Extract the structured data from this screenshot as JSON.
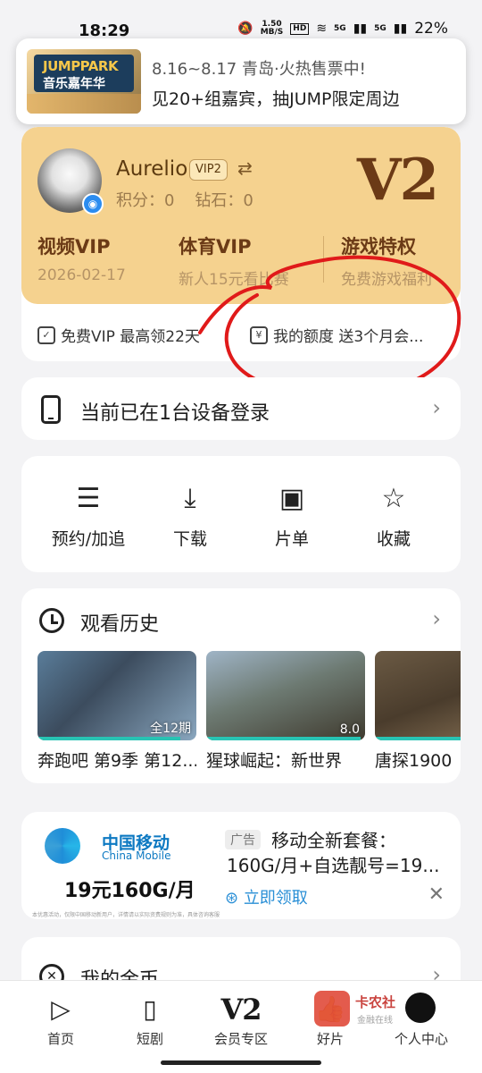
{
  "status_bar": {
    "time": "18:29",
    "speed": "1.50",
    "speed_unit": "MB/S",
    "hd": "HD",
    "net1": "5G",
    "net2": "5G",
    "battery": "22%"
  },
  "notification": {
    "thumb_brand": "JUMPPARK",
    "thumb_sub": "音乐嘉年华",
    "title": "8.16~8.17 青岛·火热售票中!",
    "body": "见20+组嘉宾，抽JUMP限定周边"
  },
  "profile": {
    "name": "Aurelio",
    "vip_badge": "VIP2",
    "points_label": "积分：",
    "points": "0",
    "diamonds_label": "钻石：",
    "diamonds": "0",
    "level_big": "V2"
  },
  "benefits": [
    {
      "title": "视频VIP",
      "sub": "2026-02-17"
    },
    {
      "title": "体育VIP",
      "sub": "新人15元看比赛"
    },
    {
      "title": "游戏特权",
      "sub": "免费游戏福利"
    }
  ],
  "vip_links": [
    {
      "label": "免费VIP 最高领22天"
    },
    {
      "label": "我的额度 送3个月会..."
    }
  ],
  "device": {
    "text": "当前已在1台设备登录"
  },
  "actions": [
    {
      "label": "预约/加追",
      "icon": "list-check-icon"
    },
    {
      "label": "下载",
      "icon": "download-icon"
    },
    {
      "label": "片单",
      "icon": "playlist-icon"
    },
    {
      "label": "收藏",
      "icon": "star-icon"
    }
  ],
  "history": {
    "title": "观看历史",
    "items": [
      {
        "label": "奔跑吧 第9季 第12...",
        "badge": "全12期",
        "progress": 0.9
      },
      {
        "label": "猩球崛起：新世界",
        "badge": "8.0",
        "progress": 0.97
      },
      {
        "label": "唐探1900",
        "badge": "",
        "progress": 0.6
      }
    ]
  },
  "ad": {
    "brand_cn": "中国移动",
    "brand_en": "China Mobile",
    "price": "19元160G/月",
    "tag": "广告",
    "text": "移动全新套餐：160G/月+自选靓号=19...",
    "cta": "立即领取",
    "fine_print": "本优惠活动，仅限中国移动新用户，详情请以实际资费规则为准，具体咨询客服"
  },
  "coins": {
    "title": "我的金币"
  },
  "nav": [
    {
      "label": "首页",
      "icon": "home-play-icon"
    },
    {
      "label": "短剧",
      "icon": "short-drama-icon"
    },
    {
      "label": "会员专区",
      "icon": "v2-vip-icon",
      "glyph": "V2"
    },
    {
      "label": "好片",
      "icon": "thumbs-up-icon"
    },
    {
      "label": "个人中心",
      "icon": "profile-icon"
    }
  ],
  "watermark": {
    "line1": "卡农社",
    "line2": "金融在线"
  },
  "colors": {
    "vip_gold": "#f5d28f",
    "vip_brown": "#6b3a16",
    "accent_teal": "#28c4b4",
    "link_blue": "#2a8fd6",
    "annotation_red": "#e01a1a"
  }
}
